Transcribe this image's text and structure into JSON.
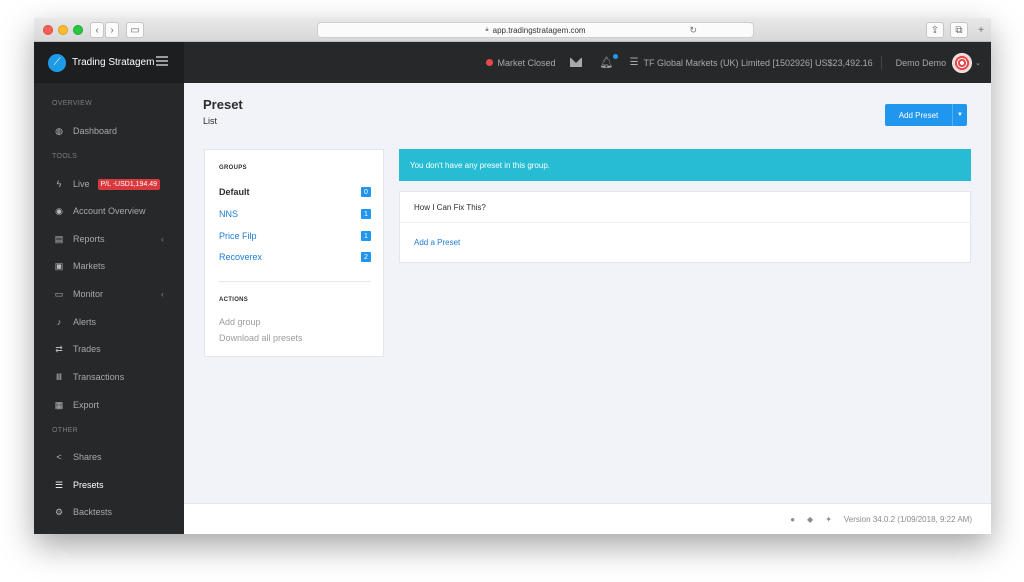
{
  "browser": {
    "url": "app.tradingstratagem.com"
  },
  "topnav": {
    "brand": "Trading Stratagem",
    "market_status": "Market Closed",
    "account": "TF Global Markets (UK) Limited [1502926] US$23,492.16",
    "user": "Demo Demo",
    "colors": {
      "market_closed_dot": "#e8484c",
      "brand_icon": "#1e9be8"
    }
  },
  "sidebar": {
    "sections": {
      "overview": "OVERVIEW",
      "tools": "TOOLS",
      "other": "OTHER"
    },
    "items": [
      {
        "label": "Dashboard",
        "icon": "dashboard-icon"
      },
      {
        "label": "Live",
        "icon": "bolt-icon",
        "badge": "P/L -USD1,194.49"
      },
      {
        "label": "Account Overview",
        "icon": "eye-icon"
      },
      {
        "label": "Reports",
        "icon": "document-icon",
        "has_submenu": true
      },
      {
        "label": "Markets",
        "icon": "money-icon"
      },
      {
        "label": "Monitor",
        "icon": "monitor-icon",
        "has_submenu": true
      },
      {
        "label": "Alerts",
        "icon": "bell-icon"
      },
      {
        "label": "Trades",
        "icon": "exchange-icon"
      },
      {
        "label": "Transactions",
        "icon": "bank-icon"
      },
      {
        "label": "Export",
        "icon": "export-icon"
      },
      {
        "label": "Shares",
        "icon": "share-icon"
      },
      {
        "label": "Presets",
        "icon": "sliders-icon",
        "active": true
      },
      {
        "label": "Backtests",
        "icon": "cogs-icon"
      }
    ]
  },
  "main": {
    "title": "Preset",
    "subtitle": "List",
    "add_button": "Add Preset",
    "groups": {
      "heading": "GROUPS",
      "items": [
        {
          "label": "Default",
          "count": "0",
          "active": true
        },
        {
          "label": "NNS",
          "count": "1"
        },
        {
          "label": "Price Filp",
          "count": "1"
        },
        {
          "label": "Recoverex",
          "count": "2"
        }
      ]
    },
    "actions": {
      "heading": "ACTIONS",
      "items": [
        "Add group",
        "Download all presets"
      ]
    },
    "alert": "You don't have any preset in this group.",
    "help": {
      "heading": "How I Can Fix This?",
      "link": "Add a Preset"
    },
    "colors": {
      "alert_bg": "#26bcd4",
      "primary": "#2196ef",
      "danger": "#d9393d"
    }
  },
  "footer": {
    "version": "Version 34.0.2 (1/09/2018, 9:22 AM)",
    "icons": [
      "apple-icon",
      "android-icon",
      "twitter-icon"
    ]
  }
}
